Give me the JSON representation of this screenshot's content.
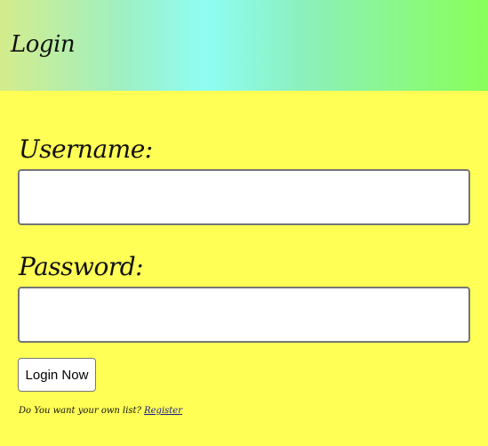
{
  "header": {
    "title": "Login"
  },
  "form": {
    "username_label": "Username:",
    "username_value": "",
    "password_label": "Password:",
    "password_value": "",
    "submit_label": "Login Now"
  },
  "footer": {
    "prompt": "Do You want your own list? ",
    "register_link": "Register"
  },
  "colors": {
    "page_background": "#ffff55",
    "header_gradient": [
      "#d4ec8c",
      "#8ffdf4",
      "#88ff59"
    ]
  }
}
